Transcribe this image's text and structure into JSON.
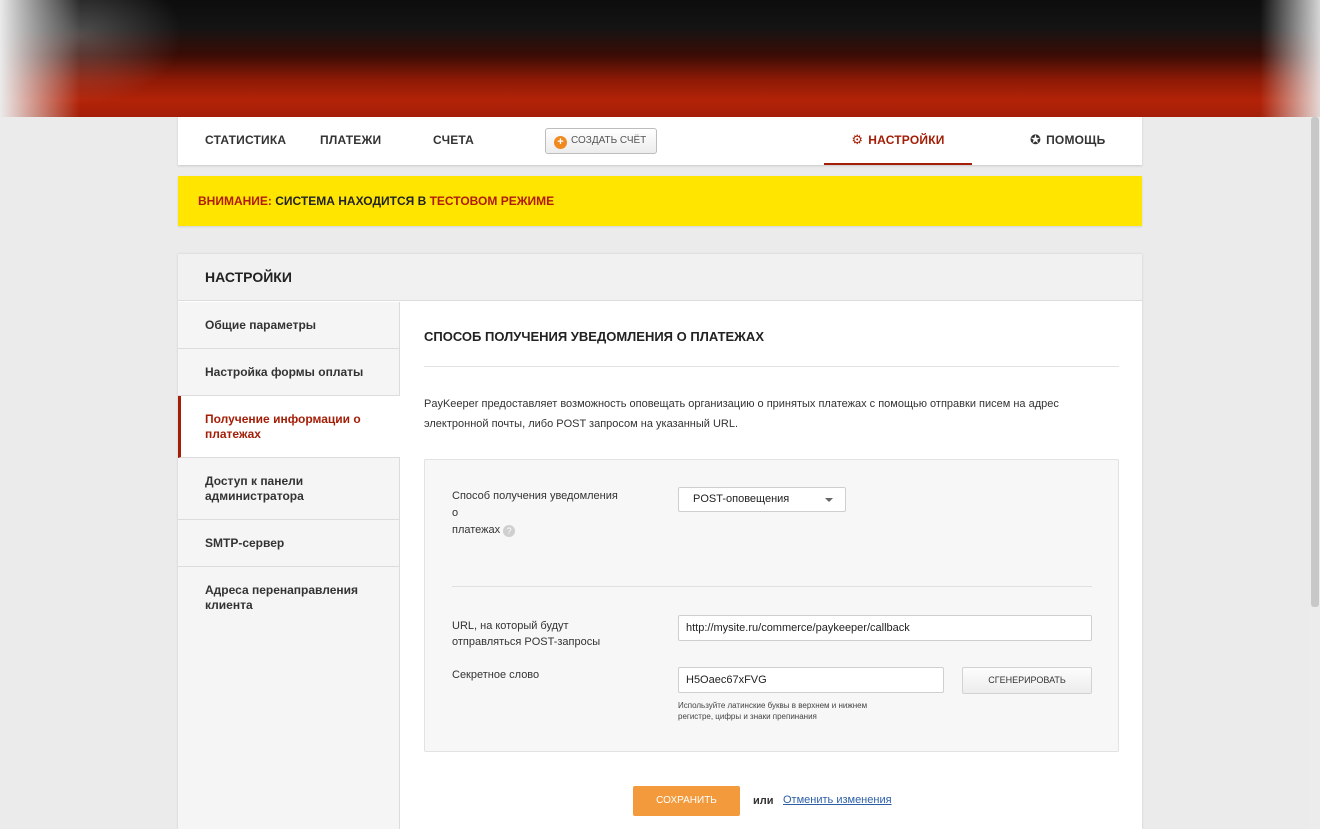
{
  "nav": {
    "items": [
      {
        "label": "Статистика"
      },
      {
        "label": "Платежи"
      },
      {
        "label": "Счета"
      }
    ],
    "create_label": "Создать счёт",
    "settings_label": "Настройки",
    "help_label": "Помощь"
  },
  "warning": {
    "prefix": "Внимание:",
    "middle": "Система находится в",
    "highlight": "тестовом режиме"
  },
  "panel": {
    "title": "Настройки",
    "sidebar": [
      {
        "label": "Общие параметры"
      },
      {
        "label": "Настройка формы оплаты"
      },
      {
        "label": "Получение информации о платежах"
      },
      {
        "label": "Доступ к панели администратора"
      },
      {
        "label": "SMTP-сервер"
      },
      {
        "label": "Адреса перенаправления клиента"
      }
    ],
    "active_index": 2
  },
  "content": {
    "title": "Способ получения уведомления о платежах",
    "description": "PayKeeper предоставляет возможность оповещать организацию о принятых платежах с помощью отправки писем на адрес электронной почты, либо POST запросом на указанный URL.",
    "method_label_1": "Способ получения уведомления",
    "method_label_2": "о",
    "method_label_3": "платежах",
    "method_value": "POST-оповещения",
    "url_label_1": "URL, на который будут",
    "url_label_2": "отправляться POST-запросы",
    "url_value": "http://mysite.ru/commerce/paykeeper/callback",
    "secret_label": "Секретное слово",
    "secret_value": "H5Oaec67xFVG",
    "generate_label": "Сгенерировать",
    "hint_1": "Используйте латинские буквы в верхнем и нижнем",
    "hint_2": "регистре, цифры и знаки препинания",
    "save_label": "Сохранить",
    "or_label": "или",
    "cancel_label": "Отменить изменения"
  },
  "colors": {
    "accent": "#a41e07",
    "warning_bg": "#ffe500",
    "save_button": "#f39a3c",
    "link": "#2c5ea8"
  },
  "icons": [
    "plus-circle-icon",
    "gear-icon",
    "lifebuoy-icon",
    "help-icon",
    "chevron-down-icon"
  ]
}
